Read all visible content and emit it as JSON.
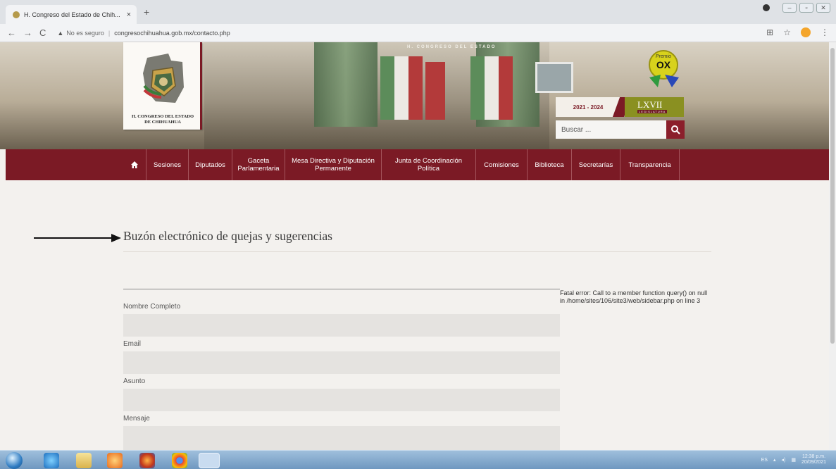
{
  "browser": {
    "tab_title": "H. Congreso del Estado de Chih...",
    "tab_close": "×",
    "new_tab": "+",
    "security_label": "No es seguro",
    "url": "congresochihuahua.gob.mx/contacto.php"
  },
  "header": {
    "logo_text_line1": "H. CONGRESO DEL ESTADO",
    "logo_text_line2": "DE CHIHUAHUA",
    "banner_text": "H. CONGRESO DEL ESTADO",
    "premio_label": "Premio",
    "premio_mark": "OX",
    "legislature_years": "2021 - 2024",
    "legislature_number": "LXVII",
    "legislature_word": "LEGISLATURA",
    "search_placeholder": "Buscar ..."
  },
  "nav": {
    "items": [
      {
        "label": "Sesiones"
      },
      {
        "label": "Diputados"
      },
      {
        "label": "Gaceta Parlamentaria"
      },
      {
        "label": "Mesa Directiva y Diputación Permanente"
      },
      {
        "label": "Junta de Coordinación Política"
      },
      {
        "label": "Comisiones"
      },
      {
        "label": "Biblioteca"
      },
      {
        "label": "Secretarías"
      },
      {
        "label": "Transparencia"
      }
    ]
  },
  "main": {
    "title": "Buzón electrónico de quejas y sugerencias",
    "fields": [
      {
        "label": "Nombre Completo",
        "value": ""
      },
      {
        "label": "Email",
        "value": ""
      },
      {
        "label": "Asunto",
        "value": ""
      },
      {
        "label": "Mensaje",
        "value": ""
      }
    ]
  },
  "sidebar": {
    "error_label": "Fatal error",
    "error_message": ": Call to a member function query() on null in",
    "error_path": "/home/sites/106/site3/web/sidebar.php",
    "error_line_prefix": " on line ",
    "error_line": "3"
  },
  "taskbar": {
    "language": "ES",
    "time": "12:38 p.m.",
    "date": "20/09/2021"
  },
  "colors": {
    "brand": "#7b1a25",
    "accent_green": "#8a9021"
  }
}
